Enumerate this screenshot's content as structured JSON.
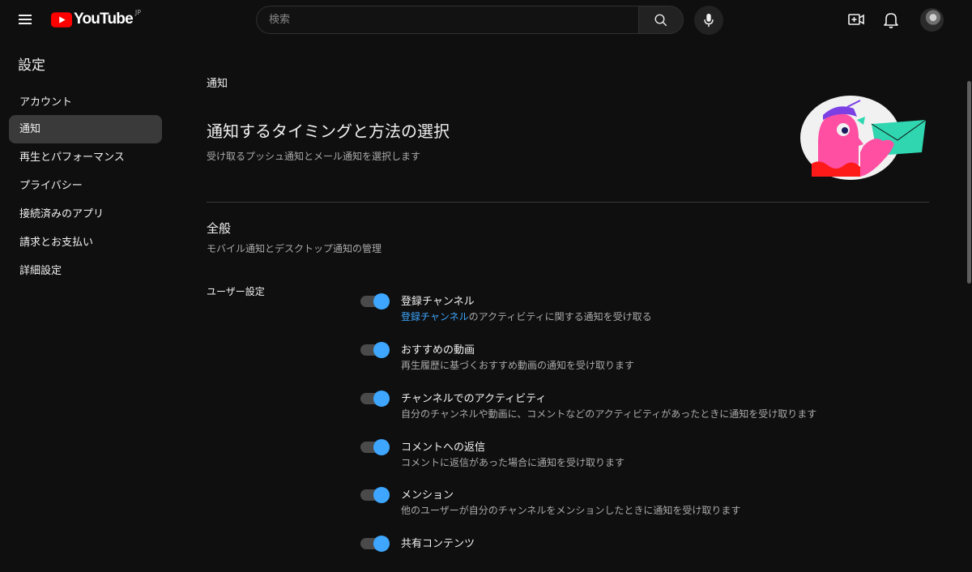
{
  "header": {
    "logo_text": "YouTube",
    "logo_region": "JP",
    "search_placeholder": "検索",
    "colors": {
      "brand": "#ff0000",
      "accent": "#3ea6ff"
    },
    "icons": [
      "menu-icon",
      "search-icon",
      "mic-icon",
      "create-video-icon",
      "bell-icon"
    ]
  },
  "sidebar": {
    "title": "設定",
    "items": [
      {
        "label": "アカウント",
        "active": false
      },
      {
        "label": "通知",
        "active": true
      },
      {
        "label": "再生とパフォーマンス",
        "active": false
      },
      {
        "label": "プライバシー",
        "active": false
      },
      {
        "label": "接続済みのアプリ",
        "active": false
      },
      {
        "label": "請求とお支払い",
        "active": false
      },
      {
        "label": "詳細設定",
        "active": false
      }
    ]
  },
  "main": {
    "breadcrumb": "通知",
    "heading": "通知するタイミングと方法の選択",
    "subheading": "受け取るプッシュ通知とメール通知を選択します",
    "section_title": "全般",
    "section_desc": "モバイル通知とデスクトップ通知の管理",
    "user_settings_label": "ユーザー設定",
    "settings": [
      {
        "title": "登録チャンネル",
        "desc_link": "登録チャンネル",
        "desc": "のアクティビティに関する通知を受け取る",
        "enabled": true
      },
      {
        "title": "おすすめの動画",
        "desc_link": "",
        "desc": "再生履歴に基づくおすすめ動画の通知を受け取ります",
        "enabled": true
      },
      {
        "title": "チャンネルでのアクティビティ",
        "desc_link": "",
        "desc": "自分のチャンネルや動画に、コメントなどのアクティビティがあったときに通知を受け取ります",
        "enabled": true
      },
      {
        "title": "コメントへの返信",
        "desc_link": "",
        "desc": "コメントに返信があった場合に通知を受け取ります",
        "enabled": true
      },
      {
        "title": "メンション",
        "desc_link": "",
        "desc": "他のユーザーが自分のチャンネルをメンションしたときに通知を受け取ります",
        "enabled": true
      },
      {
        "title": "共有コンテンツ",
        "desc_link": "",
        "desc": "",
        "enabled": true
      }
    ]
  }
}
